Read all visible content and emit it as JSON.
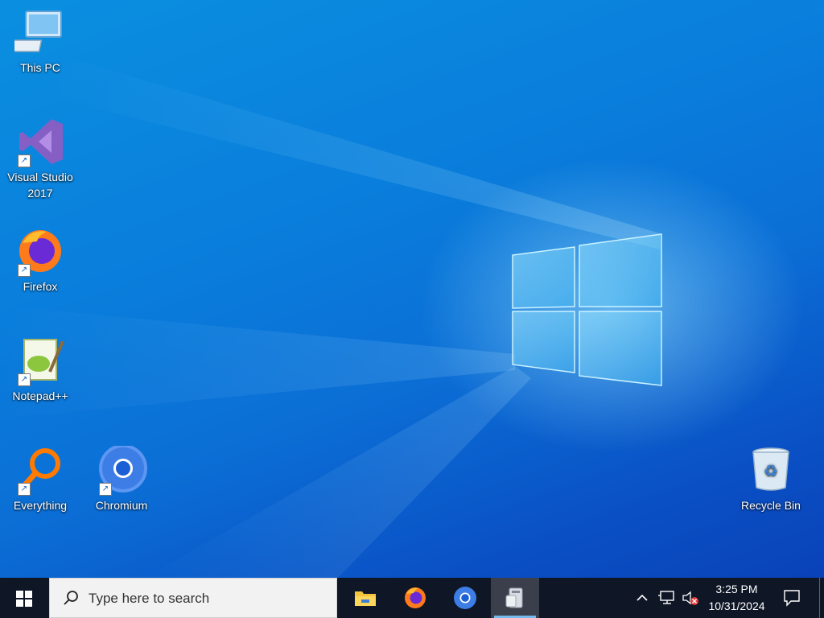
{
  "desktop": {
    "icons": [
      {
        "label": "This PC",
        "icon": "computer-icon",
        "shortcut": false
      },
      {
        "label": "Visual Studio 2017",
        "icon": "visual-studio-icon",
        "shortcut": true
      },
      {
        "label": "Firefox",
        "icon": "firefox-icon",
        "shortcut": true
      },
      {
        "label": "Notepad++",
        "icon": "notepadpp-icon",
        "shortcut": true
      },
      {
        "label": "Everything",
        "icon": "everything-search-icon",
        "shortcut": true
      },
      {
        "label": "Chromium",
        "icon": "chromium-icon",
        "shortcut": true
      },
      {
        "label": "Recycle Bin",
        "icon": "recycle-bin-icon",
        "shortcut": false
      }
    ]
  },
  "taskbar": {
    "search_placeholder": "Type here to search",
    "apps": [
      {
        "name": "File Explorer",
        "icon": "file-explorer-icon",
        "active": false
      },
      {
        "name": "Firefox",
        "icon": "firefox-icon",
        "active": false
      },
      {
        "name": "Chromium",
        "icon": "chromium-icon",
        "active": false
      },
      {
        "name": "Installer",
        "icon": "installer-icon",
        "active": true
      }
    ],
    "tray": {
      "time": "3:25 PM",
      "date": "10/31/2024"
    }
  },
  "colors": {
    "desktop_blue": "#0a7fdc",
    "taskbar": "#0f1626",
    "active_underline": "#76b9ed"
  }
}
